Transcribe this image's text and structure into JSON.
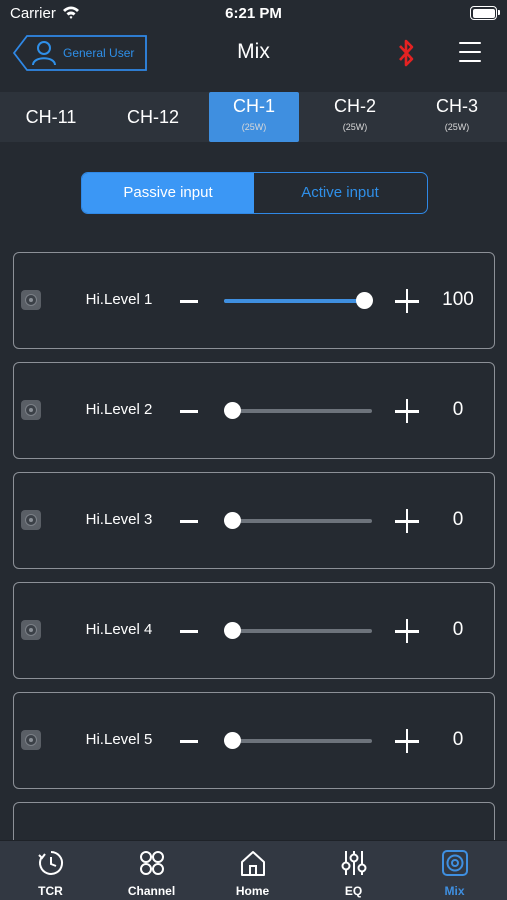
{
  "status_bar": {
    "carrier": "Carrier",
    "time": "6:21 PM"
  },
  "nav": {
    "user_label": "General User",
    "title": "Mix",
    "bluetooth_color": "#e52222",
    "accent": "#3f8fe0"
  },
  "channel_tabs": [
    {
      "name": "CH-11",
      "power": ""
    },
    {
      "name": "CH-12",
      "power": ""
    },
    {
      "name": "CH-1",
      "power": "(25W)",
      "active": true
    },
    {
      "name": "CH-2",
      "power": "(25W)"
    },
    {
      "name": "CH-3",
      "power": "(25W)"
    }
  ],
  "input_mode": {
    "passive": "Passive input",
    "active": "Active input",
    "selected": "Passive input"
  },
  "levels": [
    {
      "name": "Hi.Level 1",
      "value": "100",
      "level": 100
    },
    {
      "name": "Hi.Level 2",
      "value": "0",
      "level": 0
    },
    {
      "name": "Hi.Level 3",
      "value": "0",
      "level": 0
    },
    {
      "name": "Hi.Level 4",
      "value": "0",
      "level": 0
    },
    {
      "name": "Hi.Level 5",
      "value": "0",
      "level": 0
    }
  ],
  "tab_bar": [
    {
      "label": "TCR",
      "icon": "clock-icon"
    },
    {
      "label": "Channel",
      "icon": "grid-icon"
    },
    {
      "label": "Home",
      "icon": "home-icon"
    },
    {
      "label": "EQ",
      "icon": "sliders-icon"
    },
    {
      "label": "Mix",
      "icon": "speaker-icon",
      "active": true
    }
  ]
}
